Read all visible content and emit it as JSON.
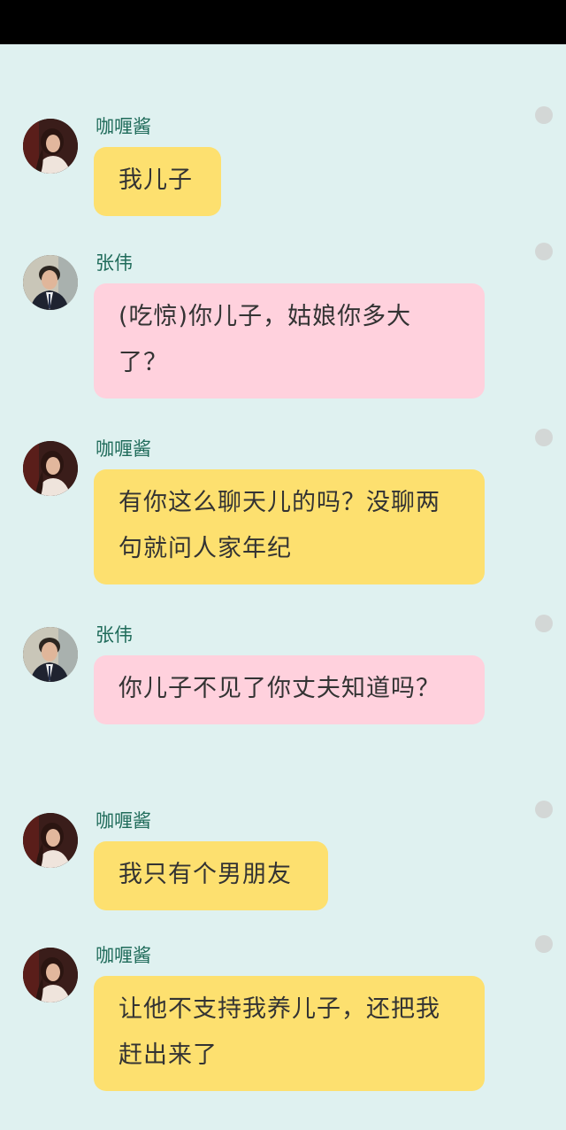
{
  "colors": {
    "background": "#dff1f0",
    "status_bar": "#000000",
    "bubble_curry": "#fde06f",
    "bubble_zhangwei": "#ffd1dd",
    "sender_name": "#1f6b5a",
    "read_dot": "#d3d7d6"
  },
  "messages": [
    {
      "sender": "咖喱酱",
      "text": "我儿子",
      "avatar": "woman-avatar"
    },
    {
      "sender": "张伟",
      "text": "(吃惊)你儿子，姑娘你多大了？",
      "avatar": "man-avatar"
    },
    {
      "sender": "咖喱酱",
      "text": "有你这么聊天儿的吗？没聊两句就问人家年纪",
      "avatar": "woman-avatar"
    },
    {
      "sender": "张伟",
      "text": "你儿子不见了你丈夫知道吗？",
      "avatar": "man-avatar"
    },
    {
      "sender": "咖喱酱",
      "text": "我只有个男朋友",
      "avatar": "woman-avatar"
    },
    {
      "sender": "咖喱酱",
      "text": "让他不支持我养儿子，还把我赶出来了",
      "avatar": "woman-avatar"
    }
  ]
}
